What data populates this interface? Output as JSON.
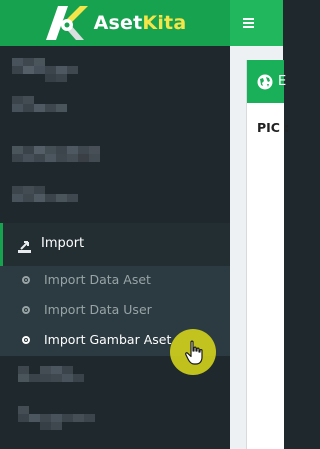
{
  "brand": {
    "name_part1": "Aset",
    "name_part2": "Kita"
  },
  "topbar": {
    "menu_icon": "hamburger-icon"
  },
  "sidebar": {
    "import_menu": {
      "label": "Import",
      "icon": "import-icon"
    },
    "import_submenu": [
      {
        "label": "Import Data Aset",
        "active": false
      },
      {
        "label": "Import Data User",
        "active": false
      },
      {
        "label": "Import Gambar Aset",
        "active": true
      }
    ]
  },
  "content": {
    "panel_title": "E",
    "pic_label": "PIC :"
  },
  "colors": {
    "brand_green": "#16a24f",
    "sidebar_bg": "#1f282c",
    "submenu_bg": "#2c3b41",
    "accent_yellow": "#f3e54a",
    "cursor_highlight": "#cdcd1c"
  }
}
